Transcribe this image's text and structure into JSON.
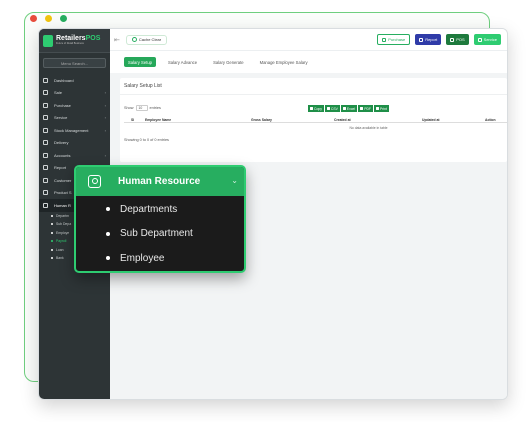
{
  "colors": {
    "accent": "#2ecc71",
    "dot_red": "#e74c3c",
    "dot_yellow": "#f1c40f",
    "dot_green": "#27ae60"
  },
  "app": {
    "logo_main": "Retailers",
    "logo_pos": "POS",
    "logo_sub": "Future of Retail Business"
  },
  "sidebar": {
    "search_placeholder": "Menu Search...",
    "items": [
      {
        "label": "Dashboard",
        "icon": "home-icon"
      },
      {
        "label": "Sale",
        "icon": "cart-icon"
      },
      {
        "label": "Purchase",
        "icon": "bag-icon"
      },
      {
        "label": "Service",
        "icon": "wrench-icon"
      },
      {
        "label": "Stock Management",
        "icon": "box-icon"
      },
      {
        "label": "Delivery",
        "icon": "truck-icon"
      },
      {
        "label": "Accounts",
        "icon": "wallet-icon"
      },
      {
        "label": "Report",
        "icon": "report-icon"
      },
      {
        "label": "Customer",
        "icon": "users-icon"
      },
      {
        "label": "Product S",
        "icon": "product-icon"
      },
      {
        "label": "Human R",
        "icon": "person-icon"
      }
    ],
    "sub_items": [
      "Departm",
      "Sub Depa",
      "Employe",
      "Payroll",
      "Loan",
      "Bank"
    ]
  },
  "topbar": {
    "cache_clear": "Cache Clear",
    "purchase": "Purchase",
    "report": "Report",
    "pos": "POS",
    "service": "Service"
  },
  "tabs": [
    "Salary Setup",
    "Salary Advance",
    "Salary Generate",
    "Manage Employee Salary"
  ],
  "card": {
    "title": "Salary Setup List",
    "show_label": "Show",
    "entries_value": "10",
    "entries_label": "entries",
    "export_buttons": [
      "Copy",
      "CSV",
      "Excel",
      "PDF",
      "Print"
    ],
    "columns": [
      "Sl",
      "Employee Name",
      "Gross Salary",
      "Created at",
      "Updated at",
      "Action"
    ],
    "no_data": "No data available in table",
    "showing": "Showing 0 to 0 of 0 entries"
  },
  "popup": {
    "title": "Human Resource",
    "items": [
      "Departments",
      "Sub Department",
      "Employee"
    ]
  }
}
